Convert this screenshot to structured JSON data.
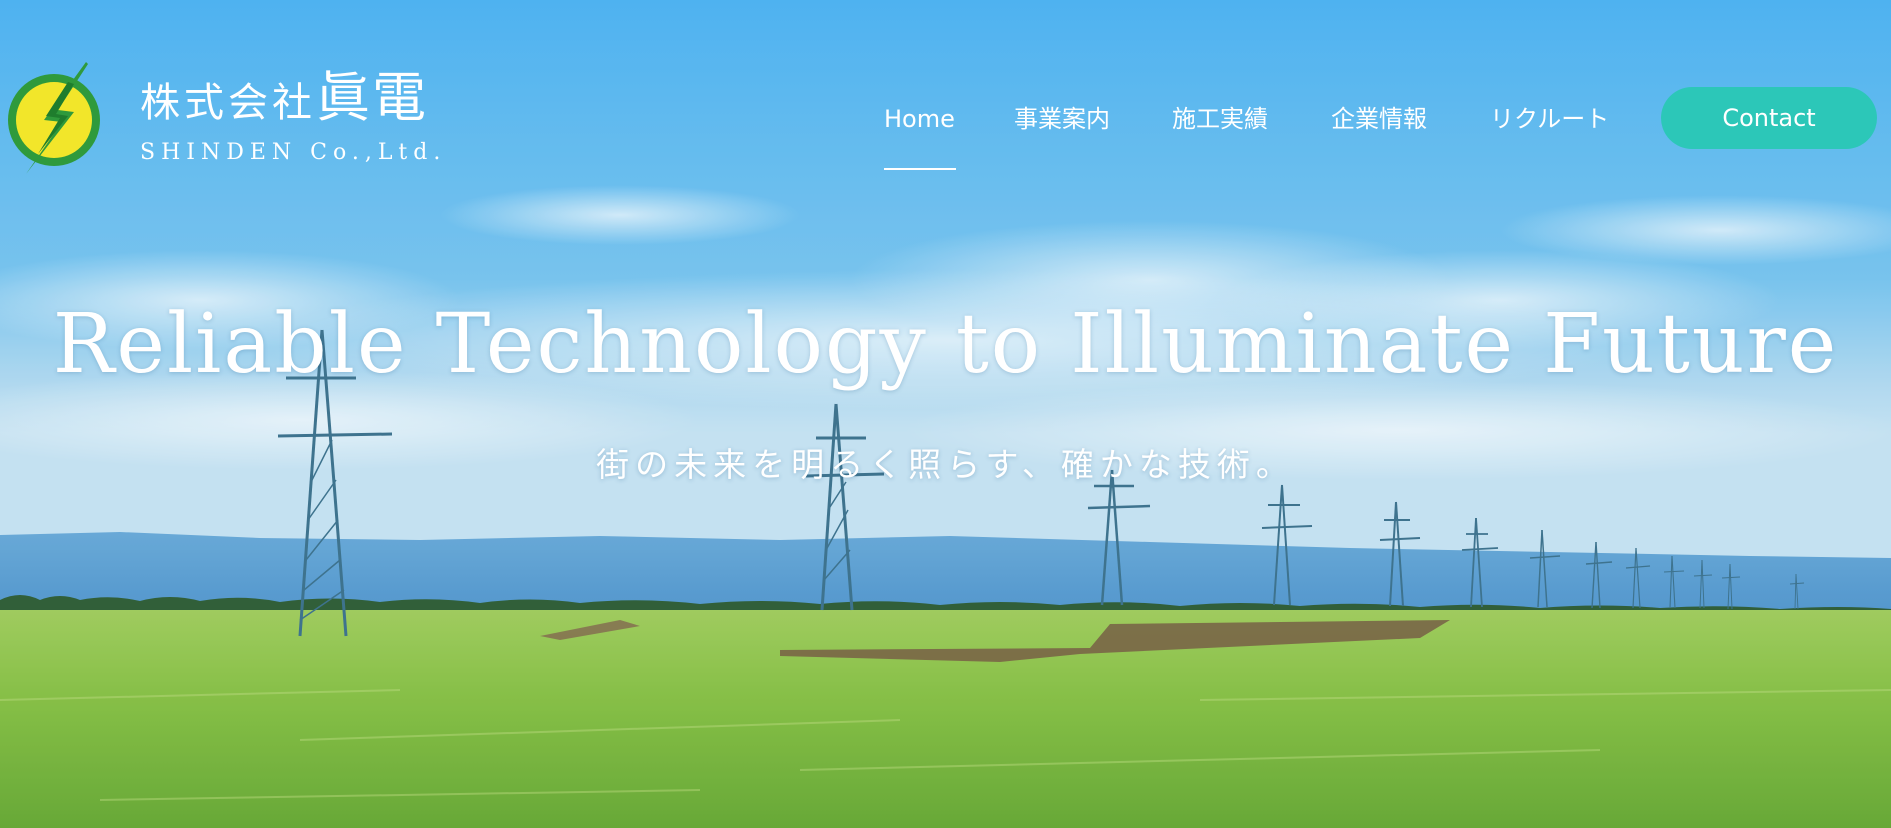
{
  "brand": {
    "name_jp_prefix": "株式会社",
    "name_jp_main": "眞電",
    "name_en": "SHINDEN Co.,Ltd.",
    "logo_icon": "lightning-bolt-icon"
  },
  "nav": {
    "items": [
      {
        "label": "Home",
        "active": true
      },
      {
        "label": "事業案内",
        "active": false
      },
      {
        "label": "施工実績",
        "active": false
      },
      {
        "label": "企業情報",
        "active": false
      },
      {
        "label": "リクルート",
        "active": false
      }
    ],
    "contact_label": "Contact"
  },
  "hero": {
    "title": "Reliable Technology to Illuminate Future",
    "subtitle": "街の未来を明るく照らす、確かな技術。"
  },
  "colors": {
    "sky": "#52b6f0",
    "field": "#8bc43c",
    "contact_button": "#2cc7b8",
    "logo_yellow": "#f2e62a",
    "logo_green": "#2f9a3c"
  }
}
